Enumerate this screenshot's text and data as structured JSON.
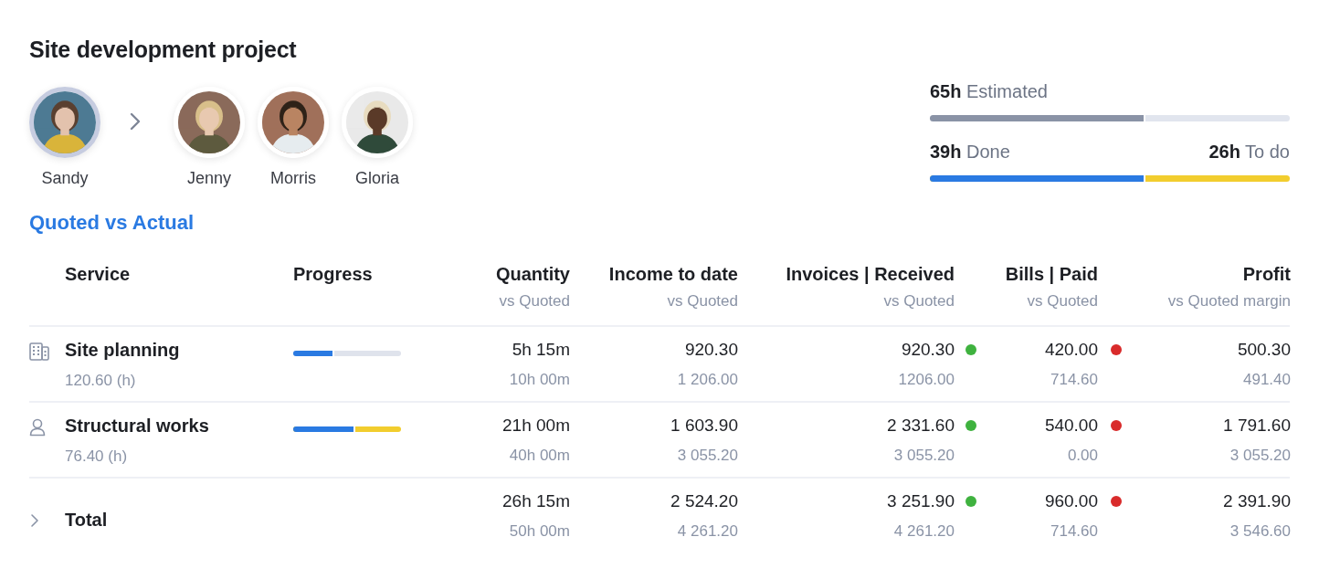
{
  "title": "Site development project",
  "owner": {
    "name": "Sandy"
  },
  "team": [
    {
      "name": "Jenny"
    },
    {
      "name": "Morris"
    },
    {
      "name": "Gloria"
    }
  ],
  "estimate": {
    "value": "65h",
    "label": "Estimated",
    "level": 0.6
  },
  "done": {
    "value": "39h",
    "label": "Done",
    "level": 0.6
  },
  "todo": {
    "value": "26h",
    "label": "To do"
  },
  "section_link": "Quoted vs Actual",
  "columns": [
    {
      "title": "Service"
    },
    {
      "title": "Progress"
    },
    {
      "title": "Quantity",
      "subtitle": "vs Quoted"
    },
    {
      "title": "Income to date",
      "subtitle": "vs Quoted"
    },
    {
      "title": "Invoices | Received",
      "subtitle": "vs Quoted"
    },
    {
      "title": "Bills | Paid",
      "subtitle": "vs Quoted"
    },
    {
      "title": "Profit",
      "subtitle": "vs Quoted margin"
    }
  ],
  "rows": [
    {
      "kind": "building",
      "service": "Site planning",
      "rate": "120.60 (h)",
      "progress": {
        "level": 0.38,
        "has_todo": false
      },
      "quantity": {
        "value": "5h 15m",
        "quoted": "10h 00m"
      },
      "income": {
        "value": "920.30",
        "quoted": "1 206.00"
      },
      "invoices": {
        "value": "920.30",
        "quoted": "1206.00",
        "color": "#3fb23f"
      },
      "bills": {
        "value": "420.00",
        "quoted": "714.60",
        "color": "#d92b2b"
      },
      "profit": {
        "value": "500.30",
        "quoted": "491.40"
      }
    },
    {
      "kind": "person",
      "service": "Structural works",
      "rate": "76.40 (h)",
      "progress": {
        "level": 0.58,
        "has_todo": true
      },
      "quantity": {
        "value": "21h 00m",
        "quoted": "40h 00m"
      },
      "income": {
        "value": "1 603.90",
        "quoted": "3 055.20"
      },
      "invoices": {
        "value": "2 331.60",
        "quoted": "3 055.20",
        "color": "#3fb23f"
      },
      "bills": {
        "value": "540.00",
        "quoted": "0.00",
        "color": "#d92b2b"
      },
      "profit": {
        "value": "1 791.60",
        "quoted": "3 055.20"
      }
    },
    {
      "kind": "total",
      "service": "Total",
      "expanded": false,
      "quantity": {
        "value": "26h 15m",
        "quoted": "50h 00m"
      },
      "income": {
        "value": "2 524.20",
        "quoted": "4 261.20"
      },
      "invoices": {
        "value": "3 251.90",
        "quoted": "4 261.20",
        "color": "#3fb23f"
      },
      "bills": {
        "value": "960.00",
        "quoted": "714.60",
        "color": "#d92b2b"
      },
      "profit": {
        "value": "2 391.90",
        "quoted": "3 546.60"
      }
    }
  ]
}
